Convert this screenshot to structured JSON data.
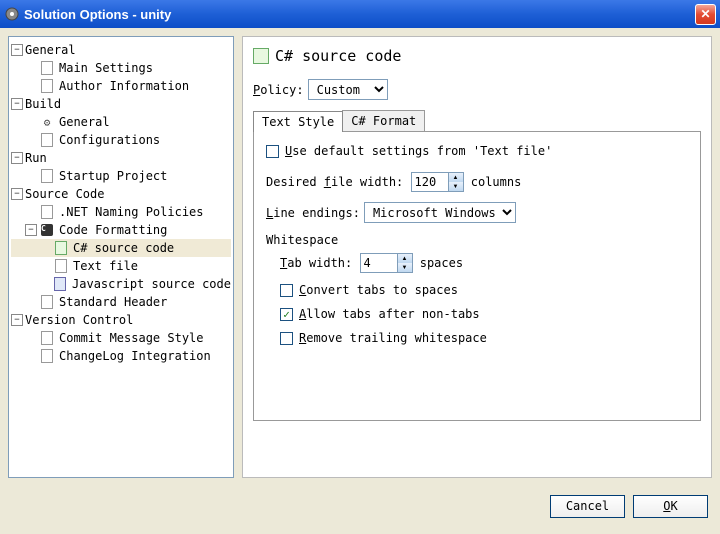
{
  "window": {
    "title": "Solution Options - unity"
  },
  "tree": {
    "general": {
      "label": "General",
      "main": "Main Settings",
      "author": "Author Information"
    },
    "build": {
      "label": "Build",
      "general": "General",
      "config": "Configurations"
    },
    "run": {
      "label": "Run",
      "startup": "Startup Project"
    },
    "source": {
      "label": "Source Code",
      "naming": ".NET Naming Policies",
      "formatting": {
        "label": "Code Formatting",
        "cs": "C# source code",
        "text": "Text file",
        "js": "Javascript source code"
      },
      "header": "Standard Header"
    },
    "vc": {
      "label": "Version Control",
      "commit": "Commit Message Style",
      "changelog": "ChangeLog Integration"
    }
  },
  "panel": {
    "heading": "C# source code",
    "policy_label": "Policy:",
    "policy_value": "Custom",
    "tabs": {
      "text_style": "Text Style",
      "csharp": "C# Format"
    },
    "use_default": "Use default settings from 'Text file'",
    "desired_width_label": "Desired file width:",
    "desired_width_value": "120",
    "columns": "columns",
    "line_endings_label": "Line endings:",
    "line_endings_value": "Microsoft Windows",
    "whitespace": "Whitespace",
    "tab_width_label": "Tab width:",
    "tab_width_value": "4",
    "spaces": "spaces",
    "convert_tabs": "Convert tabs to spaces",
    "allow_tabs": "Allow tabs after non-tabs",
    "remove_trailing": "Remove trailing whitespace",
    "allow_tabs_checked": true
  },
  "buttons": {
    "cancel": "Cancel",
    "ok": "OK"
  }
}
